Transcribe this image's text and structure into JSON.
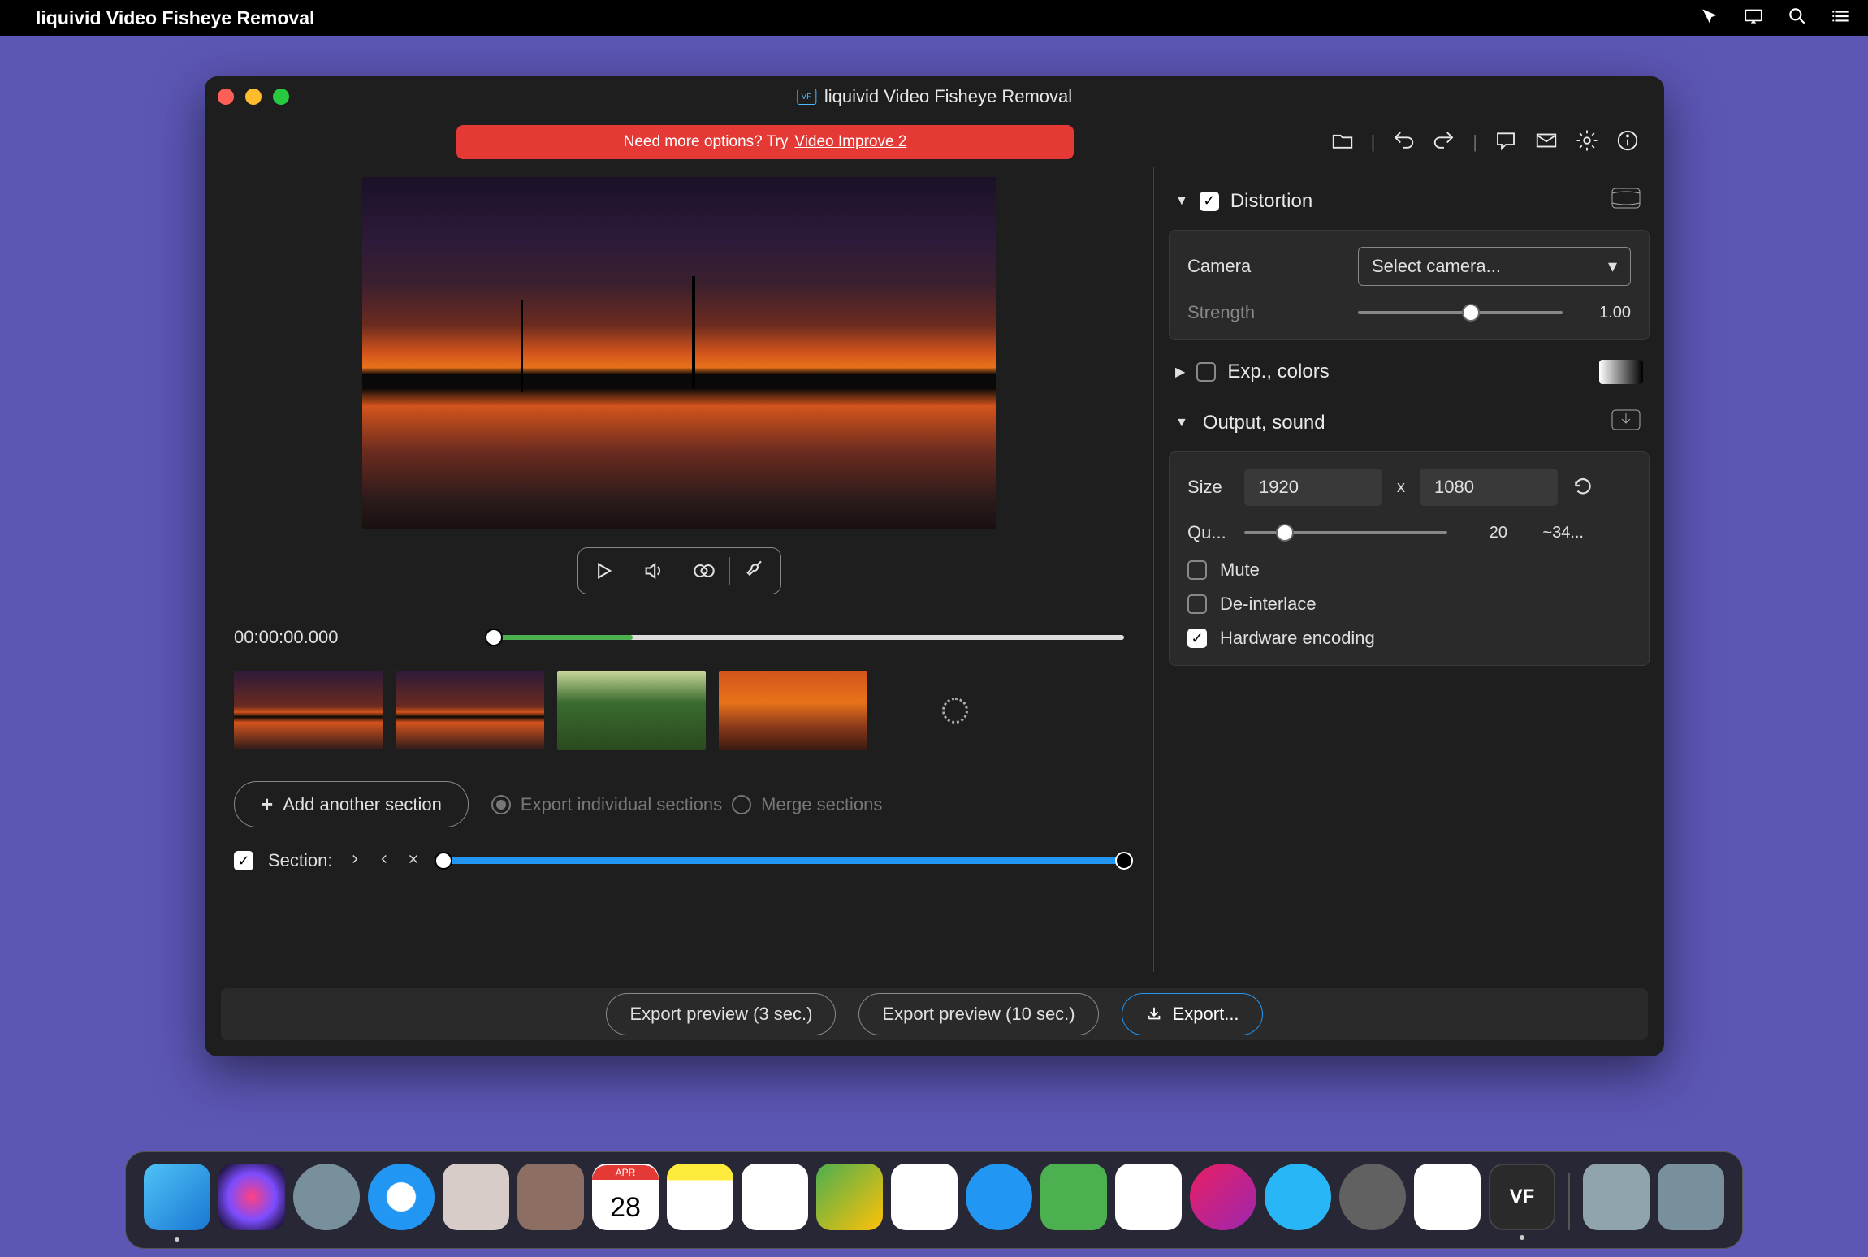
{
  "menubar": {
    "app_name": "liquivid Video Fisheye Removal"
  },
  "window": {
    "title": "liquivid Video Fisheye Removal",
    "badge": "VF"
  },
  "promo": {
    "text": "Need more options? Try",
    "link": "Video Improve 2"
  },
  "preview": {
    "timecode": "00:00:00.000"
  },
  "sections": {
    "add_label": "Add another section",
    "export_individual": "Export individual sections",
    "merge": "Merge sections",
    "section_label": "Section:"
  },
  "panels": {
    "distortion": {
      "title": "Distortion",
      "camera_label": "Camera",
      "camera_placeholder": "Select camera...",
      "strength_label": "Strength",
      "strength_value": "1.00"
    },
    "exp": {
      "title": "Exp., colors"
    },
    "output": {
      "title": "Output, sound",
      "size_label": "Size",
      "width": "1920",
      "height": "1080",
      "size_x": "x",
      "quality_label": "Qu...",
      "quality_value": "20",
      "quality_bitrate": "~34...",
      "mute": "Mute",
      "deinterlace": "De-interlace",
      "hw_encode": "Hardware encoding"
    }
  },
  "export": {
    "preview3": "Export preview (3 sec.)",
    "preview10": "Export preview (10 sec.)",
    "export": "Export..."
  },
  "dock": {
    "calendar_day": "28",
    "vf_label": "VF"
  }
}
